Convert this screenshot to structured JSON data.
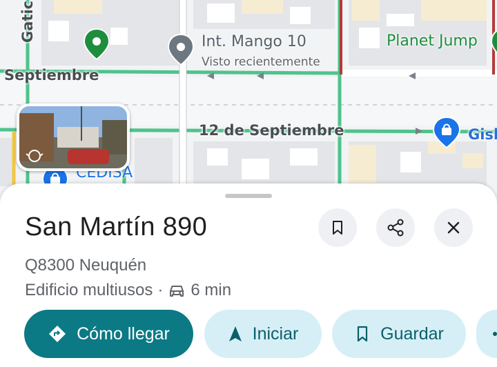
{
  "map": {
    "streets": {
      "gatica": "Gatic",
      "septiembre_left": "Septiembre",
      "doce_septiembre": "12 de Septiembre",
      "gisb": "Gisb"
    },
    "pois": {
      "int_mango": {
        "name": "Int. Mango 10",
        "subtitle": "Visto recientemente",
        "color": "#6d7780"
      },
      "planet_jump": {
        "name": "Planet Jump",
        "color": "#1e8e3e"
      },
      "cedisa": {
        "name": "CEDISA",
        "color": "#1a73e8"
      },
      "green_pin_color": "#1e8e3e",
      "shop_pin_color": "#1a73e8"
    },
    "road_color": "#4fc38d"
  },
  "place": {
    "title": "San Martín 890",
    "address": "Q8300 Neuquén",
    "category": "Edificio multiusos",
    "separator": "·",
    "drive_icon": "car-icon",
    "drive_time": "6 min"
  },
  "actions": {
    "directions": {
      "label": "Cómo llegar",
      "icon": "directions-icon"
    },
    "start": {
      "label": "Iniciar",
      "icon": "navigation-arrow-icon"
    },
    "save": {
      "label": "Guardar",
      "icon": "bookmark-icon"
    }
  },
  "header_buttons": {
    "save_icon": "bookmark-icon",
    "share_icon": "share-icon",
    "close_icon": "close-icon"
  },
  "colors": {
    "primary": "#0b7a85",
    "secondary_bg": "#d6eff6",
    "secondary_text": "#0b5f6a"
  }
}
